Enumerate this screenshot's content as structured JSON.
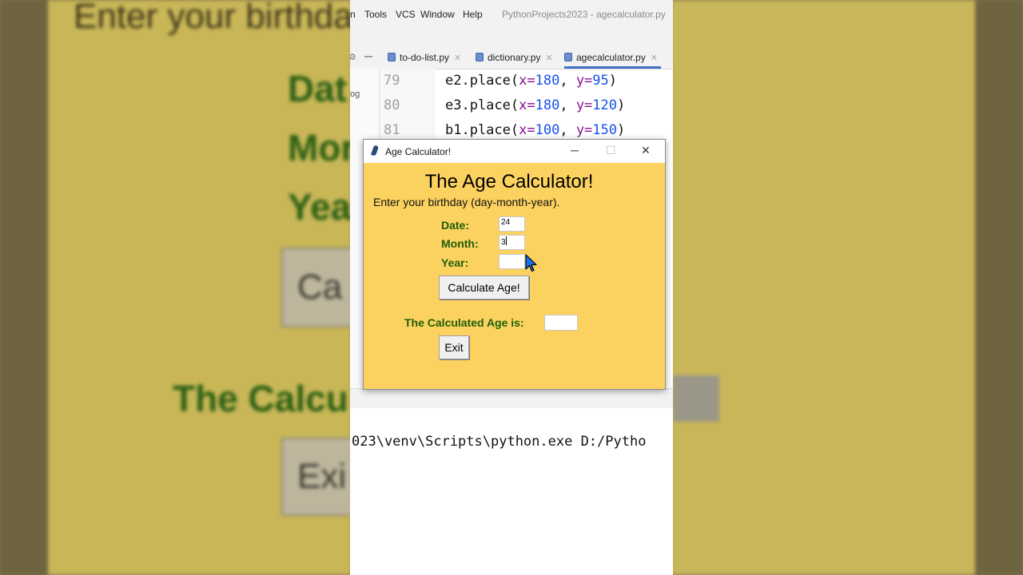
{
  "background": {
    "line1": "Enter your birthda",
    "date_label": "Dat",
    "month_label": "Mor",
    "year_label": "Yea",
    "calc_btn": "Ca",
    "result_label": "The Calcu",
    "exit_btn": "Exi"
  },
  "ide": {
    "menu": {
      "partial": "n",
      "tools": "Tools",
      "vcs": "VCS",
      "window": "Window",
      "help": "Help",
      "project_title": "PythonProjects2023 - agecalculator.py"
    },
    "tabs": [
      {
        "label": "to-do-list.py"
      },
      {
        "label": "dictionary.py"
      },
      {
        "label": "agecalculator.py"
      }
    ],
    "left_panel_text": "og",
    "line_numbers": [
      "79",
      "80",
      "81"
    ],
    "code_lines": [
      {
        "prefix": "e2.place(",
        "k1": "x=",
        "v1": "180",
        "sep": ", ",
        "k2": "y=",
        "v2": "95",
        "suffix": ")"
      },
      {
        "prefix": "e3.place(",
        "k1": "x=",
        "v1": "180",
        "sep": ", ",
        "k2": "y=",
        "v2": "120",
        "suffix": ")"
      },
      {
        "prefix": "b1.place(",
        "k1": "x=",
        "v1": "100",
        "sep": ", ",
        "k2": "y=",
        "v2": "150",
        "suffix": ")"
      }
    ],
    "console_line": "023\\venv\\Scripts\\python.exe D:/Pytho"
  },
  "window": {
    "title": "Age Calculator!",
    "minimize": "─",
    "maximize": "☐",
    "close": "✕",
    "heading": "The Age Calculator!",
    "instruction": "Enter your birthday (day-month-year).",
    "date_label": "Date:",
    "month_label": "Month:",
    "year_label": "Year:",
    "date_value": "24",
    "month_value": "3",
    "year_value": "",
    "calculate_button": "Calculate Age!",
    "result_label": "The Calculated Age is:",
    "result_value": "",
    "exit_button": "Exit"
  },
  "colors": {
    "window_bg": "#fbd25f",
    "label_green": "#1f5d0a",
    "keyword": "#871094",
    "number": "#1750eb"
  }
}
